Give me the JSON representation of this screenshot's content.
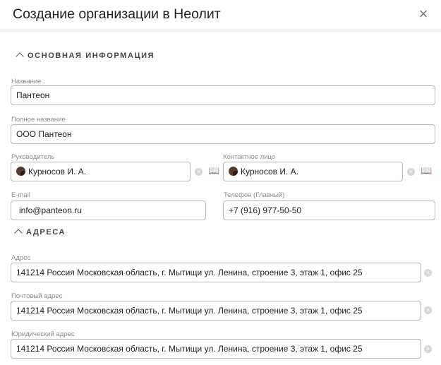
{
  "dialog": {
    "title": "Создание организации в Неолит",
    "close_symbol": "×"
  },
  "sections": {
    "basic": "ОСНОВНАЯ ИНФОРМАЦИЯ",
    "addresses": "АДРЕСА"
  },
  "fields": {
    "name": {
      "label": "Название",
      "value": "Пантеон"
    },
    "full_name": {
      "label": "Полное название",
      "value": "ООО Пантеон"
    },
    "head": {
      "label": "Руководитель",
      "value": "Курносов И. А."
    },
    "contact": {
      "label": "Контактное лицо",
      "value": "Курносов И. А."
    },
    "email": {
      "label": "E-mail",
      "value": "info@panteon.ru"
    },
    "phone": {
      "label": "Телефон (Главный)",
      "value": "+7 (916) 977-50-50"
    },
    "address": {
      "label": "Адрес",
      "value": "141214 Россия Московская область, г. Мытищи ул. Ленина, строение 3, этаж 1, офис 25"
    },
    "postal_address": {
      "label": "Почтовый адрес",
      "value": "141214 Россия Московская область, г. Мытищи ул. Ленина, строение 3, этаж 1, офис 25"
    },
    "legal_address": {
      "label": "Юридический адрес",
      "value": "141214 Россия Московская область, г. Мытищи ул. Ленина, строение 3, этаж 1, офис 25"
    }
  },
  "icons": {
    "close": "close-icon",
    "clear": "clear-icon",
    "directory": "book-icon",
    "chevron": "chevron-up-icon",
    "avatar": "avatar"
  },
  "colors": {
    "border": "#b7b7b7",
    "label": "#8a8a8a",
    "clear_button": "#d6d6d6"
  }
}
